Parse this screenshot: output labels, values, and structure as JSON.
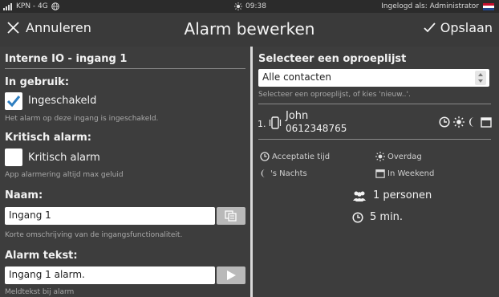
{
  "status_bar": {
    "carrier": "KPN - 4G",
    "time": "09:38",
    "login_text": "Ingelogd als: Administrator"
  },
  "title_bar": {
    "cancel_label": "Annuleren",
    "title": "Alarm bewerken",
    "save_label": "Opslaan"
  },
  "left": {
    "section_title": "Interne IO - ingang 1",
    "in_use": {
      "label": "In gebruik:",
      "checkbox_label": "Ingeschakeld",
      "checked": true,
      "hint": "Het alarm op deze ingang is ingeschakeld."
    },
    "critical": {
      "label": "Kritisch alarm:",
      "checkbox_label": "Kritisch alarm",
      "checked": false,
      "hint": "App alarmering altijd max geluid"
    },
    "name": {
      "label": "Naam:",
      "value": "Ingang 1",
      "hint": "Korte omschrijving van de ingangsfunctionaliteit."
    },
    "alarm_text": {
      "label": "Alarm tekst:",
      "value": "Ingang 1 alarm.",
      "hint": "Meldtekst bij alarm"
    }
  },
  "right": {
    "section_title": "Selecteer een oproeplijst",
    "call_list": {
      "selected": "Alle contacten",
      "hint": "Selecteer een oproeplijst, of kies 'nieuw..'."
    },
    "contact": {
      "index": "1.",
      "name": "John",
      "phone": "0612348765"
    },
    "legend": {
      "accept_time": "Acceptatie tijd",
      "overdag": "Overdag",
      "nachts": "'s Nachts",
      "weekend": "In Weekend"
    },
    "summary": {
      "persons": "1 personen",
      "duration": "5 min."
    }
  },
  "colors": {
    "background": "#3a3a3a",
    "checkbox_accent": "#2f7fc1",
    "divider": "#d9d9d9"
  }
}
